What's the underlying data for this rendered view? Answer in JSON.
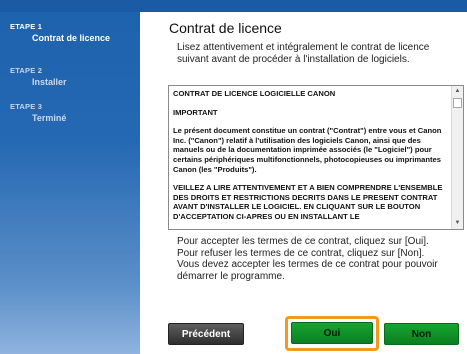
{
  "sidebar": {
    "steps": [
      {
        "number": "ETAPE 1",
        "label": "Contrat de licence",
        "active": true
      },
      {
        "number": "ETAPE 2",
        "label": "Installer",
        "active": false
      },
      {
        "number": "ETAPE 3",
        "label": "Terminé",
        "active": false
      }
    ]
  },
  "main": {
    "title": "Contrat de licence",
    "intro": "Lisez attentivement et intégralement le contrat de licence suivant avant de procéder à l'installation de logiciels.",
    "license": {
      "heading": "CONTRAT DE LICENCE LOGICIELLE CANON",
      "important": "IMPORTANT",
      "paragraph1": "Le présent document constitue un contrat (\"Contrat\") entre vous et Canon Inc. (\"Canon\") relatif à l'utilisation des logiciels Canon, ainsi que des manuels ou de la documentation imprimée associés (le \"Logiciel\") pour certains périphériques multifonctionnels, photocopieuses ou imprimantes Canon (les \"Produits\").",
      "paragraph2": "VEILLEZ A LIRE ATTENTIVEMENT ET A BIEN COMPRENDRE L'ENSEMBLE DES DROITS ET RESTRICTIONS DECRITS DANS LE PRESENT CONTRAT AVANT D'INSTALLER LE LOGICIEL.  EN CLIQUANT SUR LE BOUTON D'ACCEPTATION CI-APRES OU EN INSTALLANT LE"
    },
    "accept_line1": "Pour accepter les termes de ce contrat, cliquez sur [Oui].",
    "accept_line2": "Pour refuser les termes de ce contrat, cliquez sur [Non].",
    "accept_line3": "Vous devez accepter les termes de ce contrat pour pouvoir démarrer le programme."
  },
  "buttons": {
    "back": "Précédent",
    "yes": "Oui",
    "no": "Non"
  },
  "colors": {
    "sidebar": "#2568b3",
    "accent_green": "#12962b",
    "highlight": "#f29a1c"
  }
}
